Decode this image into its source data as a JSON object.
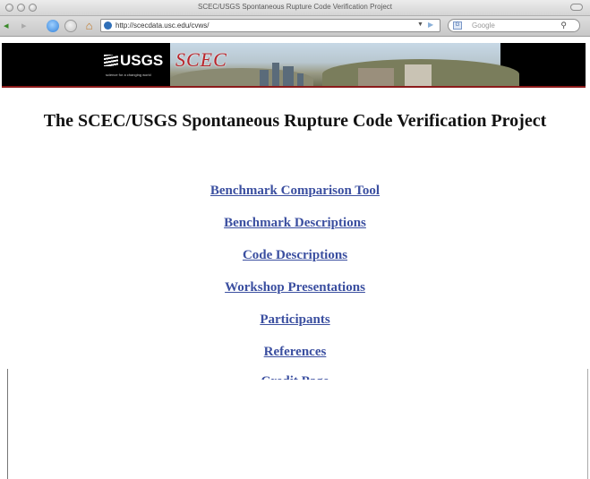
{
  "window": {
    "title": "SCEC/USGS Spontaneous Rupture Code Verification Project"
  },
  "toolbar": {
    "back": "◂",
    "forward": "▸",
    "home": "⌂",
    "url": "http://scecdata.usc.edu/cvws/",
    "search_placeholder": "Google",
    "search_engine_glyph": "G"
  },
  "banner": {
    "logo_text": "USGS",
    "tagline": "science for a changing world",
    "scec_logo": "SCEC"
  },
  "page": {
    "title": "The SCEC/USGS Spontaneous Rupture Code Verification Project",
    "links": [
      "Benchmark Comparison Tool",
      "Benchmark Descriptions",
      "Code Descriptions",
      "Workshop Presentations",
      "Participants",
      "References",
      "Credit Page"
    ]
  },
  "colors": {
    "link": "#3b4fa0",
    "banner_bg": "#000000",
    "banner_rule": "#8b1a1a",
    "scec_red": "#b9252b"
  }
}
